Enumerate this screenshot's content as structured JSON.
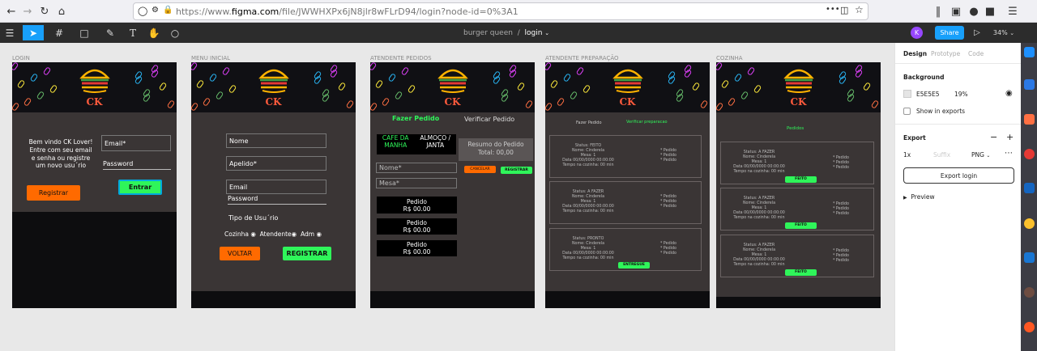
{
  "browser": {
    "url_prefix": "https://www.",
    "url_domain": "figma.com",
    "url_rest": "/file/JWWHXPx6jN8jlr8wFLrD94/login?node-id=0%3A1",
    "more": "•••",
    "icons": [
      "back-icon",
      "forward-icon",
      "reload-icon",
      "home-icon",
      "shield-icon",
      "lock-icon",
      "bookmark-icon",
      "library-icon",
      "reader-icon",
      "account-icon",
      "extension-icon",
      "menu-icon"
    ]
  },
  "toolbar": {
    "file": "burger queen",
    "sep": "/",
    "page": "login",
    "avatar": "K",
    "share": "Share",
    "zoom": "34%"
  },
  "frames": [
    {
      "label": "LOGIN"
    },
    {
      "label": "MENU INICIAL"
    },
    {
      "label": "ATENDENTE PEDIDOS"
    },
    {
      "label": "ATENDENTE PREPARAÇÃO"
    },
    {
      "label": "COZINHA"
    }
  ],
  "logo_text": "CK",
  "login": {
    "welcome_l1": "Bem vindo CK Lover!",
    "welcome_l2": "Entre com seu email",
    "welcome_l3": "e senha ou registre",
    "welcome_l4": "um novo usu´rio",
    "email": "Email*",
    "password": "Password",
    "register": "Registrar",
    "enter": "Entrar"
  },
  "menu": {
    "name": "Nome",
    "nickname": "Apelido*",
    "email": "Email",
    "password": "Password",
    "user_type": "Tipo de Usu´rio",
    "opt1": "Cozinha",
    "opt2": "Atendente",
    "opt3": "Adm",
    "back": "VOLTAR",
    "register": "REGISTRAR"
  },
  "atendente": {
    "tab1": "Fazer Pedido",
    "tab2": "Verificar Pedido",
    "cat1_l1": "CAFE DA",
    "cat1_l2": "MANHA",
    "cat2_l1": "ALMOÇO /",
    "cat2_l2": "JANTA",
    "summary": "Resumo do Pedido",
    "total": "Total: 00,00",
    "name": "Nome*",
    "table": "Mesa*",
    "cancel": "CANCELAR",
    "register": "REGISTRAR",
    "items": [
      {
        "title": "Pedido",
        "price": "R$ 00.00"
      },
      {
        "title": "Pedido",
        "price": "R$ 00.00"
      },
      {
        "title": "Pedido",
        "price": "R$ 00.00"
      }
    ]
  },
  "preparacao": {
    "tab1": "Fazer Pedido",
    "tab2": "Verificar preparacao",
    "deliver": "ENTREGUE",
    "cards": [
      {
        "status": "Status: FEITO",
        "name": "Nome: Cinderela",
        "table": "Mesa: 1",
        "date": "Data 00/00/0000 00:00:00",
        "time": "Tempo na cozinha: 00 min",
        "items": [
          "* Pedido",
          "* Pedido",
          "* Pedido"
        ]
      },
      {
        "status": "Status: A FAZER",
        "name": "Nome: Cinderela",
        "table": "Mesa: 1",
        "date": "Data 00/00/0000 00:00:00",
        "time": "Tempo na cozinha: 00 min",
        "items": [
          "* Pedido",
          "* Pedido",
          "* Pedido"
        ]
      },
      {
        "status": "Status: PRONTO",
        "name": "Nome: Cinderela",
        "table": "Mesa: 1",
        "date": "Data 00/00/0000 00:00:00",
        "time": "Tempo na cozinha: 00 min",
        "items": [
          "* Pedido",
          "* Pedido",
          "* Pedido"
        ]
      }
    ]
  },
  "cozinha": {
    "title": "Pedidos",
    "done": "FEITO",
    "cards": [
      {
        "status": "Status: A FAZER",
        "name": "Nome: Cinderela",
        "table": "Mesa: 1",
        "date": "Data 00/00/0000 00:00:00",
        "time": "Tempo na cozinha: 00 min",
        "items": [
          "* Pedido",
          "* Pedido",
          "* Pedido"
        ]
      },
      {
        "status": "Status: A FAZER",
        "name": "Nome: Cinderela",
        "table": "Mesa: 1",
        "date": "Data 00/00/0000 00:00:00",
        "time": "Tempo na cozinha: 00 min",
        "items": [
          "* Pedido",
          "* Pedido",
          "* Pedido"
        ]
      },
      {
        "status": "Status: A FAZER",
        "name": "Nome: Cinderela",
        "table": "Mesa: 1",
        "date": "Data 00/00/0000 00:00:00",
        "time": "Tempo na cozinha: 00 min",
        "items": [
          "* Pedido",
          "* Pedido",
          "* Pedido"
        ]
      }
    ]
  },
  "panel": {
    "tabs": [
      "Design",
      "Prototype",
      "Code"
    ],
    "background": "Background",
    "bg_hex": "E5E5E5",
    "bg_opacity": "19%",
    "show_exports": "Show in exports",
    "export": "Export",
    "scale": "1x",
    "suffix": "Suffix",
    "format": "PNG",
    "export_btn": "Export login",
    "preview": "Preview"
  },
  "colors": {
    "share": "#18a0fb",
    "avatar": "#9747ff",
    "green": "#2ff55a",
    "orange": "#ff6a00"
  }
}
